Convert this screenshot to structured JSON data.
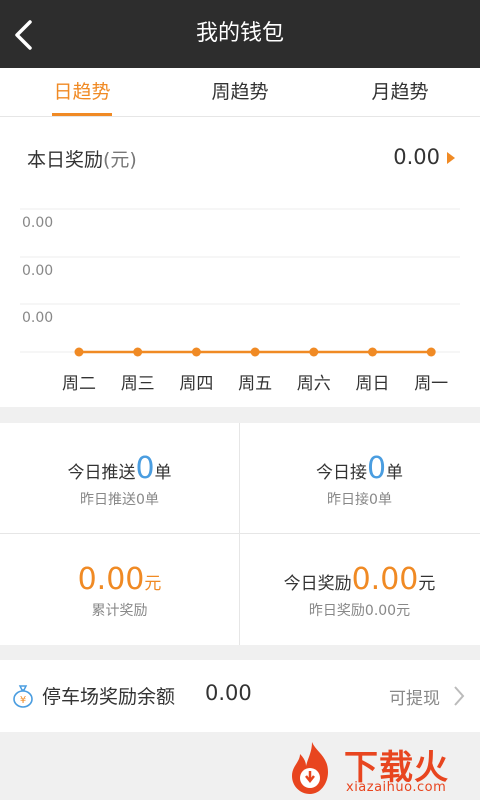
{
  "header": {
    "title": "我的钱包",
    "back_icon": "back-arrow-icon"
  },
  "tabs": [
    {
      "label": "日趋势",
      "active": true
    },
    {
      "label": "周趋势",
      "active": false
    },
    {
      "label": "月趋势",
      "active": false
    }
  ],
  "daily_reward": {
    "label": "本日奖励",
    "unit": "(元)",
    "value": "0.00"
  },
  "chart_data": {
    "type": "line",
    "categories": [
      "周二",
      "周三",
      "周四",
      "周五",
      "周六",
      "周日",
      "周一"
    ],
    "values": [
      0,
      0,
      0,
      0,
      0,
      0,
      0
    ],
    "y_tick_labels": [
      "0.00",
      "0.00",
      "0.00"
    ],
    "color": "#f08a24",
    "grid": true
  },
  "stats": {
    "today_push": {
      "prefix": "今日推送",
      "value": "0",
      "suffix": "单",
      "sub": "昨日推送0单"
    },
    "today_accept": {
      "prefix": "今日接",
      "value": "0",
      "suffix": "单",
      "sub": "昨日接0单"
    },
    "total_reward": {
      "value": "0.00",
      "suffix": "元",
      "sub": "累计奖励"
    },
    "today_reward": {
      "prefix": "今日奖励",
      "value": "0.00",
      "suffix": "元",
      "sub": "昨日奖励0.00元"
    }
  },
  "parking": {
    "label": "停车场奖励余额",
    "value": "0.00",
    "action": "可提现"
  },
  "watermark": {
    "text": "下载火",
    "url": "xiazaihuo.com"
  },
  "colors": {
    "accent": "#f08a24",
    "blue": "#4a9de0",
    "header_bg": "#2d2d2d"
  }
}
